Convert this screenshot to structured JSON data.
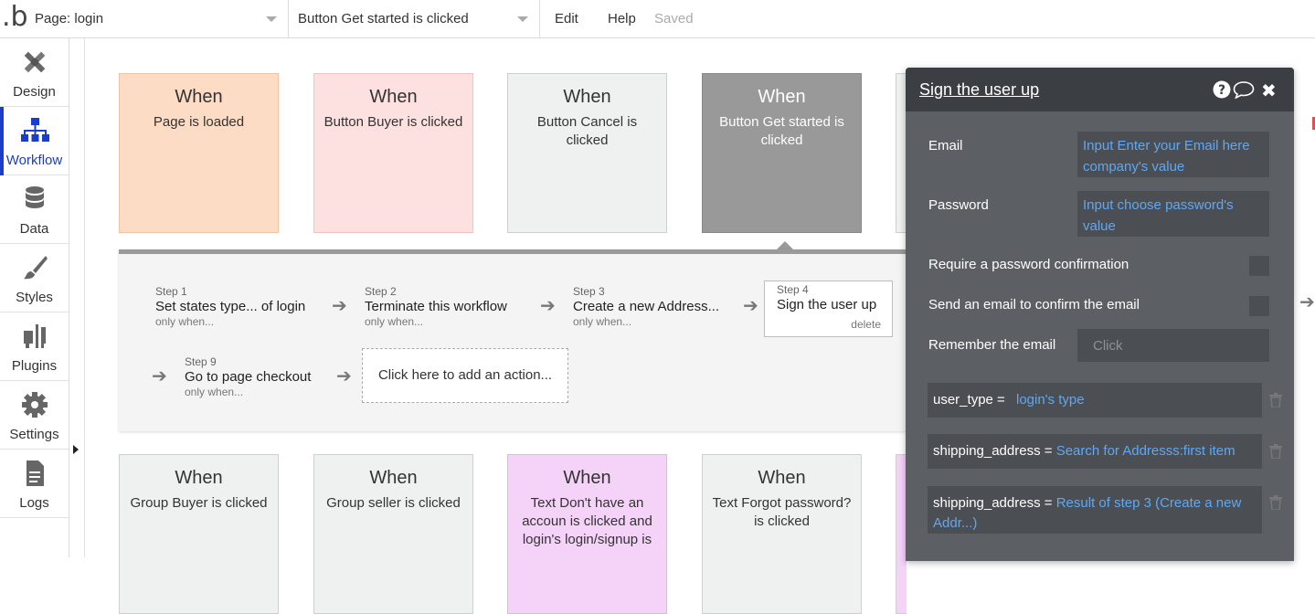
{
  "topbar": {
    "logo": ".b",
    "page_select": "Page: login",
    "workflow_select": "Button Get started is clicked",
    "menu": [
      "Edit",
      "Help"
    ],
    "status": "Saved"
  },
  "sidebar": {
    "items": [
      {
        "label": "Design",
        "icon": "design-icon"
      },
      {
        "label": "Workflow",
        "icon": "workflow-icon",
        "active": true
      },
      {
        "label": "Data",
        "icon": "database-icon"
      },
      {
        "label": "Styles",
        "icon": "brush-icon"
      },
      {
        "label": "Plugins",
        "icon": "plugins-icon"
      },
      {
        "label": "Settings",
        "icon": "gear-icon"
      },
      {
        "label": "Logs",
        "icon": "document-icon"
      }
    ]
  },
  "events_top": [
    {
      "when": "When",
      "text": "Page is loaded",
      "color": "#fcdcc4"
    },
    {
      "when": "When",
      "text": "Button Buyer is clicked",
      "color": "#fde0e0"
    },
    {
      "when": "When",
      "text": "Button Cancel is clicked",
      "color": "#eff1f0"
    },
    {
      "when": "When",
      "text": "Button Get started is clicked",
      "color": "#999999"
    }
  ],
  "events_bottom": [
    {
      "when": "When",
      "text": "Group Buyer is clicked",
      "color": "#eff1f0"
    },
    {
      "when": "When",
      "text": "Group seller is clicked",
      "color": "#eff1f0"
    },
    {
      "when": "When",
      "text": "Text Don't have an accoun is clicked and login's login/signup is",
      "color": "#f5d3f9"
    },
    {
      "when": "When",
      "text": "Text Forgot password? is clicked",
      "color": "#eff1f0"
    }
  ],
  "steps": [
    {
      "num": "Step 1",
      "name": "Set states type... of login",
      "cond": "only when..."
    },
    {
      "num": "Step 2",
      "name": "Terminate this workflow",
      "cond": "only when..."
    },
    {
      "num": "Step 3",
      "name": "Create a new Address...",
      "cond": "only when..."
    },
    {
      "num": "Step 4",
      "name": "Sign the user up",
      "delete": "delete"
    },
    {
      "num": "Step 9",
      "name": "Go to page checkout",
      "cond": "only when..."
    }
  ],
  "add_action": "Click here to add an action...",
  "modal": {
    "title": "Sign the user up",
    "fields": [
      {
        "label": "Email",
        "value": "Input Enter your Email here company's value"
      },
      {
        "label": "Password",
        "value": "Input choose password's value"
      }
    ],
    "checks": [
      "Require a password confirmation",
      "Send an email to confirm the email"
    ],
    "remember_label": "Remember the email",
    "remember_value": "Click",
    "params": [
      {
        "key": "user_type",
        "eq": "=",
        "value": "login's type"
      },
      {
        "key": "shipping_address",
        "eq": "=",
        "value": "Search for Addresss:first item"
      },
      {
        "key": "shipping_address",
        "eq": "=",
        "value": "Result of step 3 (Create a new Addr...)"
      }
    ]
  },
  "colors": {
    "accent": "#1a3ec9",
    "link": "#5ea8f5",
    "modal_bg": "#5c5f63"
  }
}
